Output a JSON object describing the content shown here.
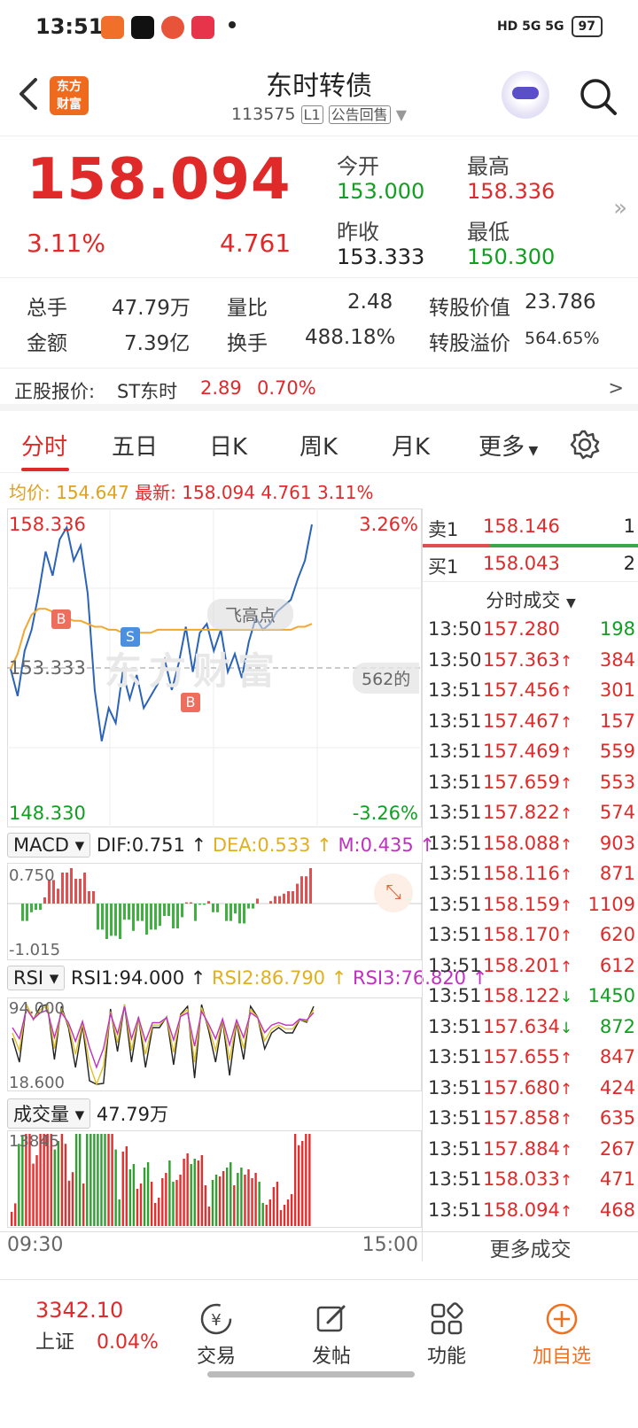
{
  "status": {
    "time": "13:51",
    "signal": "HD 5G 5G",
    "battery": "97"
  },
  "header": {
    "brand": "东方\n财富",
    "brand_line1": "东方",
    "brand_line2": "财富",
    "title": "东时转债",
    "code": "113575",
    "level": "L1",
    "tag": "公告回售"
  },
  "quote": {
    "price": "158.094",
    "change_pct": "3.11%",
    "change_amt": "4.761",
    "open_label": "今开",
    "open": "153.000",
    "high_label": "最高",
    "high": "158.336",
    "prev_label": "昨收",
    "prev": "153.333",
    "low_label": "最低",
    "low": "150.300"
  },
  "stats": {
    "vol_label": "总手",
    "vol": "47.79万",
    "ratio_label": "量比",
    "ratio": "2.48",
    "conv_label": "转股价值",
    "conv": "23.786",
    "amount_label": "金额",
    "amount": "7.39亿",
    "turnover_label": "换手",
    "turnover": "488.18%",
    "premium_label": "转股溢价",
    "premium": "564.65%"
  },
  "underlying": {
    "label": "正股报价:",
    "name": "ST东时",
    "price": "2.89",
    "pct": "0.70%",
    "arrow": ">"
  },
  "tabs": [
    "分时",
    "五日",
    "日K",
    "周K",
    "月K",
    "更多"
  ],
  "info": {
    "avg_label": "均价:",
    "avg": "154.647",
    "latest_label": "最新:",
    "latest": "158.094",
    "chg": "4.761",
    "pct": "3.11%"
  },
  "chart": {
    "top_price": "158.336",
    "top_pct": "3.26%",
    "mid_price": "153.333",
    "bottom_price": "148.330",
    "bottom_pct": "-3.26%",
    "watermark": "东方财富",
    "popup": "飞高点",
    "popup2": "562的",
    "marker_b": "B",
    "marker_s": "S"
  },
  "chart_data": {
    "type": "line",
    "title": "",
    "ylim": [
      148.33,
      158.336
    ],
    "series": [
      {
        "name": "",
        "values": [
          153.3,
          152.4,
          153.9,
          154.6,
          155.8,
          157.2,
          156.4,
          157.6,
          158.0,
          156.9,
          157.4,
          155.8,
          152.6,
          150.9,
          152.0,
          151.5,
          153.2,
          152.3,
          153.1,
          152.0,
          152.4,
          152.8,
          153.6,
          152.6,
          153.5,
          154.7,
          153.2,
          154.5,
          154.8,
          153.9,
          154.6,
          153.2,
          153.8,
          153.0,
          154.2,
          155.0,
          154.6,
          154.8,
          155.2,
          155.4,
          155.6,
          156.3,
          156.9,
          158.1
        ]
      },
      {
        "name": "",
        "values": [
          153.3,
          153.8,
          154.6,
          155.1,
          155.3,
          155.3,
          155.2,
          155.1,
          155.0,
          154.9,
          154.9,
          154.8,
          154.7,
          154.7,
          154.6,
          154.6,
          154.5,
          154.5,
          154.5,
          154.5,
          154.5,
          154.6,
          154.6,
          154.6,
          154.6,
          154.6,
          154.6,
          154.6,
          154.6,
          154.6,
          154.6,
          154.6,
          154.6,
          154.6,
          154.6,
          154.6,
          154.6,
          154.6,
          154.6,
          154.6,
          154.6,
          154.7,
          154.7,
          154.8
        ]
      }
    ]
  },
  "macd": {
    "label": "MACD",
    "dif": "DIF:0.751",
    "dea": "DEA:0.533",
    "m": "M:0.435",
    "top": "0.750",
    "bottom": "-1.015"
  },
  "rsi": {
    "label": "RSI",
    "r1": "RSI1:94.000",
    "r2": "RSI2:86.790",
    "r3": "RSI3:76.820",
    "top": "94.000",
    "bottom": "18.600"
  },
  "volume": {
    "label": "成交量",
    "total": "47.79万",
    "max": "13845"
  },
  "time_axis": {
    "start": "09:30",
    "end": "15:00"
  },
  "orderbook": {
    "sell_label": "卖1",
    "sell_price": "158.146",
    "sell_vol": "1",
    "buy_label": "买1",
    "buy_price": "158.043",
    "buy_vol": "2",
    "trades_title": "分时成交"
  },
  "trades": [
    {
      "time": "13:50",
      "price": "157.280",
      "vol": "198",
      "dir": ""
    },
    {
      "time": "13:50",
      "price": "157.363",
      "vol": "384",
      "dir": "↑"
    },
    {
      "time": "13:51",
      "price": "157.456",
      "vol": "301",
      "dir": "↑"
    },
    {
      "time": "13:51",
      "price": "157.467",
      "vol": "157",
      "dir": "↑"
    },
    {
      "time": "13:51",
      "price": "157.469",
      "vol": "559",
      "dir": "↑"
    },
    {
      "time": "13:51",
      "price": "157.659",
      "vol": "553",
      "dir": "↑"
    },
    {
      "time": "13:51",
      "price": "157.822",
      "vol": "574",
      "dir": "↑"
    },
    {
      "time": "13:51",
      "price": "158.088",
      "vol": "903",
      "dir": "↑"
    },
    {
      "time": "13:51",
      "price": "158.116",
      "vol": "871",
      "dir": "↑"
    },
    {
      "time": "13:51",
      "price": "158.159",
      "vol": "1109",
      "dir": "↑"
    },
    {
      "time": "13:51",
      "price": "158.170",
      "vol": "620",
      "dir": "↑"
    },
    {
      "time": "13:51",
      "price": "158.201",
      "vol": "612",
      "dir": "↑"
    },
    {
      "time": "13:51",
      "price": "158.122",
      "vol": "1450",
      "dir": "↓"
    },
    {
      "time": "13:51",
      "price": "157.634",
      "vol": "872",
      "dir": "↓"
    },
    {
      "time": "13:51",
      "price": "157.655",
      "vol": "847",
      "dir": "↑"
    },
    {
      "time": "13:51",
      "price": "157.680",
      "vol": "424",
      "dir": "↑"
    },
    {
      "time": "13:51",
      "price": "157.858",
      "vol": "635",
      "dir": "↑"
    },
    {
      "time": "13:51",
      "price": "157.884",
      "vol": "267",
      "dir": "↑"
    },
    {
      "time": "13:51",
      "price": "158.033",
      "vol": "471",
      "dir": "↑"
    },
    {
      "time": "13:51",
      "price": "158.094",
      "vol": "468",
      "dir": "↑"
    }
  ],
  "more_trades": "更多成交",
  "bottom_nav": {
    "index_value": "3342.10",
    "index_name": "上证",
    "index_pct": "0.04%",
    "trade": "交易",
    "post": "发帖",
    "functions": "功能",
    "watchlist": "加自选"
  }
}
